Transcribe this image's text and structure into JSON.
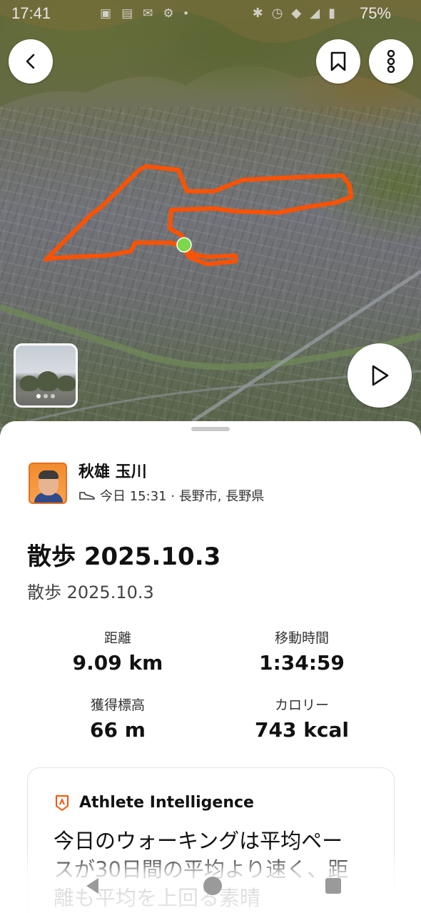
{
  "status_bar": {
    "time": "17:41",
    "battery": "75%",
    "left_icons": [
      "photo-icon",
      "chat-icon",
      "mail-icon",
      "settings-icon",
      "dot-icon"
    ],
    "right_icons": [
      "bluetooth-icon",
      "alarm-icon",
      "wifi-icon",
      "signal-icon",
      "battery-icon"
    ]
  },
  "map": {
    "route_color": "#FC5200",
    "start_marker_color": "#7CD84B",
    "thumbnail_pages": 3,
    "thumbnail_active_page": 1
  },
  "activity": {
    "athlete_name": "秋雄 玉川",
    "meta": "今日 15:31 · 長野市, 長野県",
    "activity_icon": "shoe-icon",
    "title": "散歩 2025.10.3",
    "subtitle": "散歩 2025.10.3"
  },
  "stats": [
    {
      "label": "距離",
      "value": "9.09 km"
    },
    {
      "label": "移動時間",
      "value": "1:34:59"
    },
    {
      "label": "獲得標高",
      "value": "66 m"
    },
    {
      "label": "カロリー",
      "value": "743 kcal"
    }
  ],
  "athlete_intelligence": {
    "title": "Athlete Intelligence",
    "icon": "athlete-intelligence-icon",
    "body": "今日のウォーキングは平均ペースが30日間の平均より速く、距離も平均を上回る素晴"
  },
  "colors": {
    "accent": "#FC5200",
    "text": "#111111",
    "muted": "#444444"
  }
}
